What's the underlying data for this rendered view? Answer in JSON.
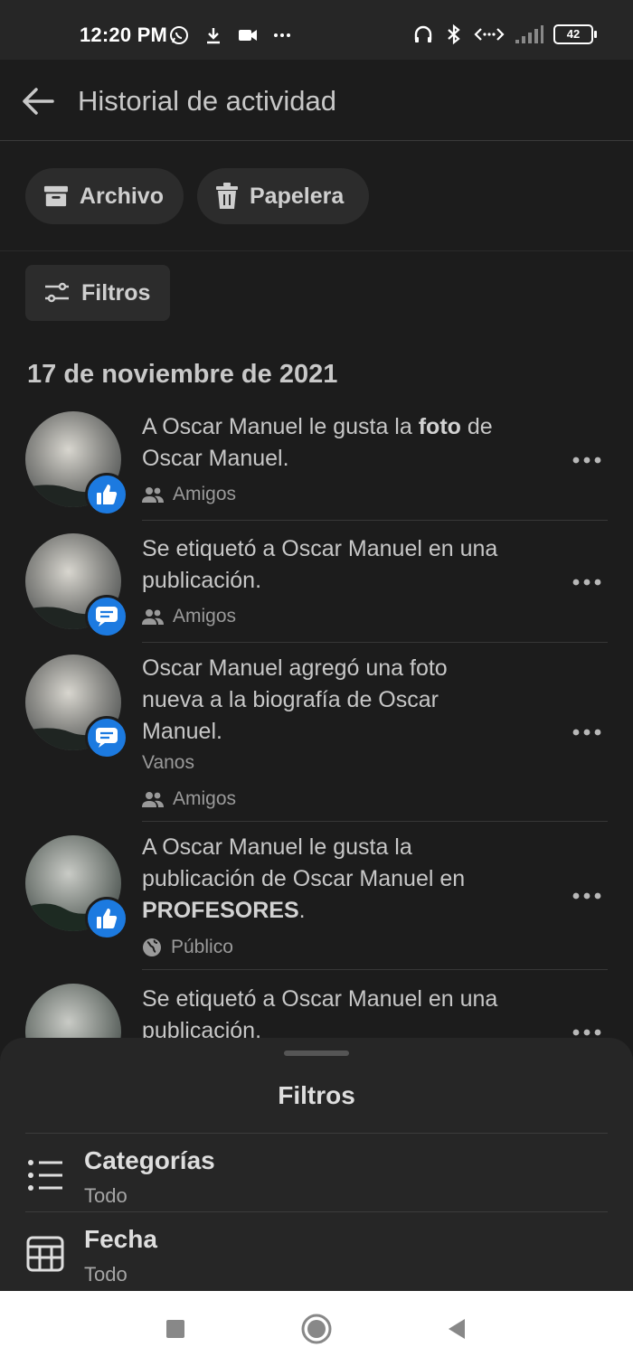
{
  "status_bar": {
    "time": "12:20 PM",
    "left_icons": [
      "whatsapp-icon",
      "download-icon",
      "video-icon",
      "more-dots-icon"
    ],
    "right_icons": [
      "headphones-icon",
      "bluetooth-icon",
      "data-arrows-icon",
      "signal-icon"
    ],
    "battery": "42"
  },
  "header": {
    "title": "Historial de actividad"
  },
  "chips": {
    "archivo": "Archivo",
    "papelera": "Papelera"
  },
  "filter_button": "Filtros",
  "date_heading": "17 de noviembre de 2021",
  "activities": [
    {
      "text_a": "A Oscar Manuel le gusta la ",
      "bold": "foto",
      "text_b": " de Oscar Manuel.",
      "privacy": "Amigos",
      "badge": "like"
    },
    {
      "text_a": "Se etiquetó a Oscar Manuel en una publicación.",
      "privacy": "Amigos",
      "badge": "comment"
    },
    {
      "text_a": "Oscar Manuel agregó una foto nueva a la biografía de Oscar Manuel.",
      "sub": "Vanos",
      "privacy": "Amigos",
      "badge": "comment"
    },
    {
      "text_a": "A Oscar Manuel le gusta la publicación de Oscar Manuel en ",
      "bold": "PROFESORES",
      "text_b": ".",
      "privacy": "Público",
      "badge": "like"
    },
    {
      "text_a": "Se etiquetó a Oscar Manuel en una publicación."
    }
  ],
  "sheet": {
    "title": "Filtros",
    "items": [
      {
        "label": "Categorías",
        "value": "Todo"
      },
      {
        "label": "Fecha",
        "value": "Todo"
      }
    ]
  },
  "colors": {
    "accent": "#1c7ae0",
    "background": "#1c1c1c",
    "sheet": "#262626"
  }
}
